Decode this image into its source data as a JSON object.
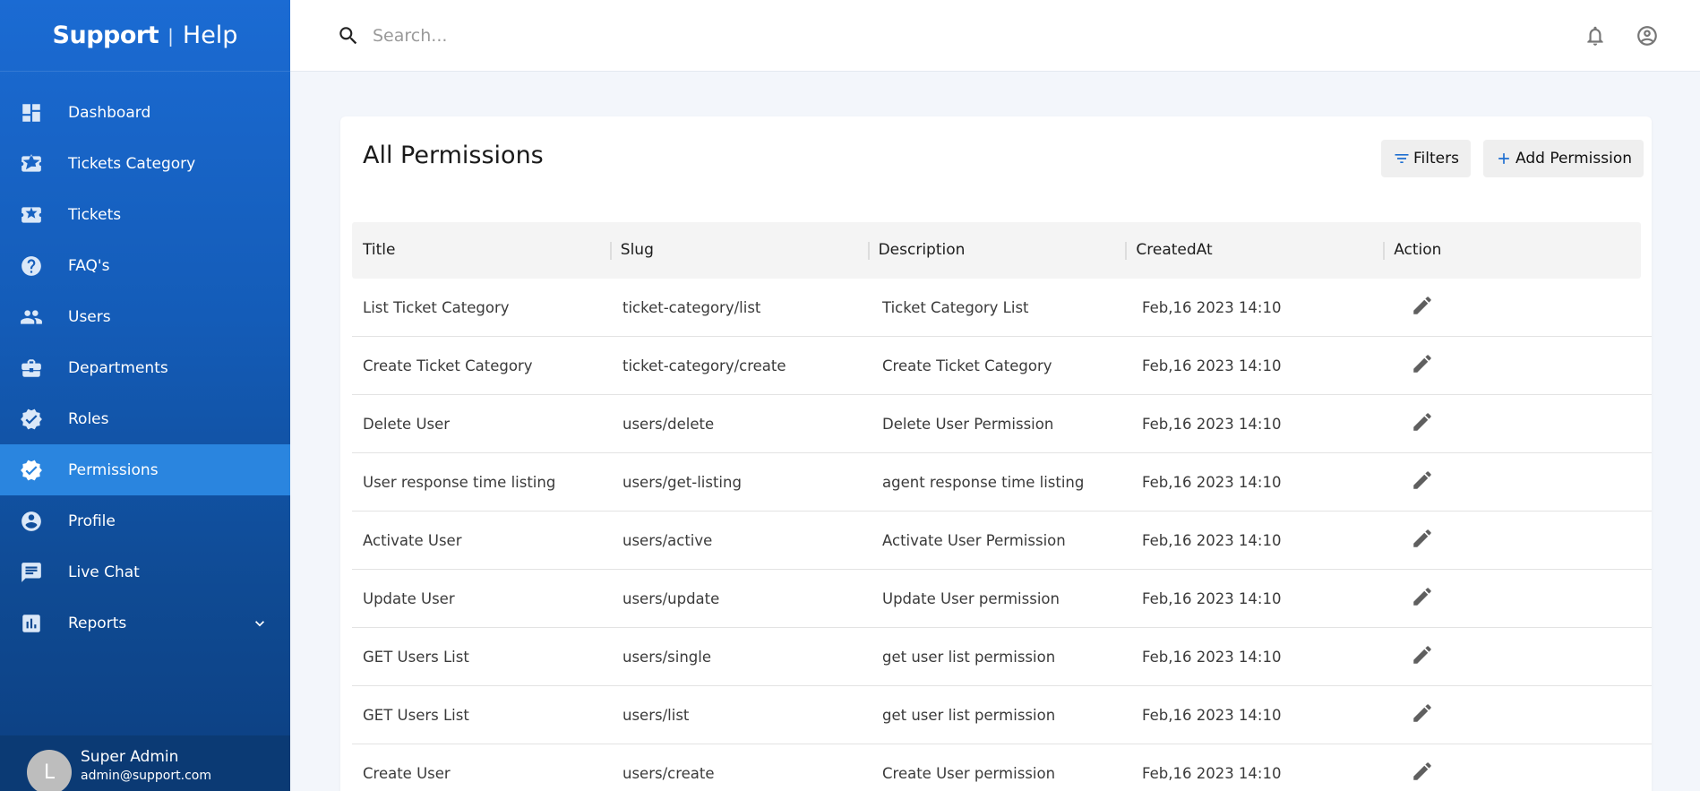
{
  "brand": {
    "name_bold": "Support",
    "separator": "|",
    "name_light": "Help"
  },
  "sidebar": {
    "items": [
      {
        "label": "Dashboard",
        "icon": "dashboard-icon"
      },
      {
        "label": "Tickets Category",
        "icon": "ticket-icon"
      },
      {
        "label": "Tickets",
        "icon": "ticket-icon"
      },
      {
        "label": "FAQ's",
        "icon": "help-circle-icon"
      },
      {
        "label": "Users",
        "icon": "people-icon"
      },
      {
        "label": "Departments",
        "icon": "briefcase-icon"
      },
      {
        "label": "Roles",
        "icon": "verified-badge-icon"
      },
      {
        "label": "Permissions",
        "icon": "verified-badge-icon",
        "active": true
      },
      {
        "label": "Profile",
        "icon": "account-circle-icon"
      },
      {
        "label": "Live Chat",
        "icon": "chat-icon"
      },
      {
        "label": "Reports",
        "icon": "bar-chart-icon",
        "expandable": true
      }
    ],
    "user": {
      "avatar_letter": "L",
      "name": "Super Admin",
      "email": "admin@support.com"
    }
  },
  "header": {
    "search_placeholder": "Search..."
  },
  "main": {
    "title": "All Permissions",
    "filters_label": "Filters",
    "add_label": "Add Permission",
    "columns": [
      "Title",
      "Slug",
      "Description",
      "CreatedAt",
      "Action"
    ],
    "rows": [
      {
        "title": "List Ticket Category",
        "slug": "ticket-category/list",
        "description": "Ticket Category List",
        "created_at": "Feb,16 2023 14:10"
      },
      {
        "title": "Create Ticket Category",
        "slug": "ticket-category/create",
        "description": "Create Ticket Category",
        "created_at": "Feb,16 2023 14:10"
      },
      {
        "title": "Delete User",
        "slug": "users/delete",
        "description": "Delete User Permission",
        "created_at": "Feb,16 2023 14:10"
      },
      {
        "title": "User response time listing",
        "slug": "users/get-listing",
        "description": "agent response time listing",
        "created_at": "Feb,16 2023 14:10"
      },
      {
        "title": "Activate User",
        "slug": "users/active",
        "description": "Activate User Permission",
        "created_at": "Feb,16 2023 14:10"
      },
      {
        "title": "Update User",
        "slug": "users/update",
        "description": "Update User permission",
        "created_at": "Feb,16 2023 14:10"
      },
      {
        "title": "GET Users List",
        "slug": "users/single",
        "description": "get user list permission",
        "created_at": "Feb,16 2023 14:10"
      },
      {
        "title": "GET Users List",
        "slug": "users/list",
        "description": "get user list permission",
        "created_at": "Feb,16 2023 14:10"
      },
      {
        "title": "Create User",
        "slug": "users/create",
        "description": "Create User permission",
        "created_at": "Feb,16 2023 14:10"
      }
    ]
  },
  "colors": {
    "sidebar_top": "#1b6bd3",
    "sidebar_bottom": "#0c3f80",
    "active_item": "#2a85df",
    "accent": "#1f6fd1"
  }
}
